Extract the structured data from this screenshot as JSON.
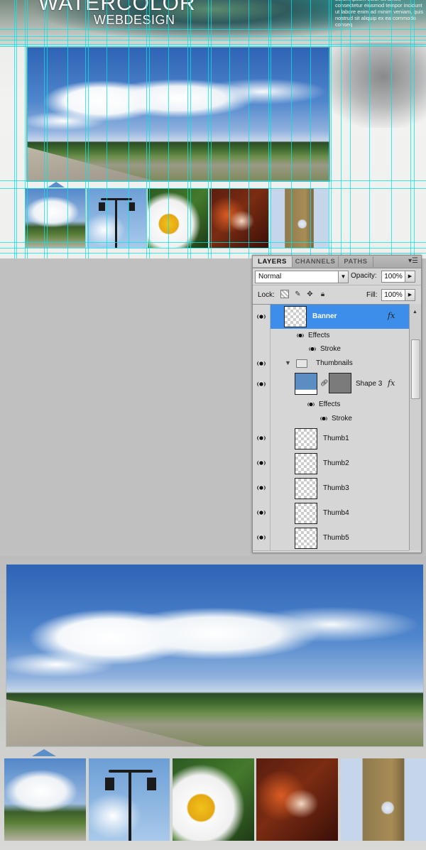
{
  "canvas": {
    "logo_title": "WATERCOLOR",
    "logo_subtitle": "WEBDESIGN",
    "lorem_text": "Lorem ipsum dolor sit amet, consectetur eiusmod tempor incidunt ut labore enim ad minim veniam, quis nostrud sit aliquip ex ea commodo conseq",
    "banner_image": "landscape-clouds-road",
    "thumbnails": [
      "clouds-landscape",
      "street-lamp",
      "bee-on-daisy",
      "violin-hands",
      "big-ben-clock"
    ]
  },
  "layers_panel": {
    "tabs": [
      "LAYERS",
      "CHANNELS",
      "PATHS"
    ],
    "active_tab": "LAYERS",
    "menu_icon": "panel-menu-icon",
    "blend_mode": "Normal",
    "opacity_label": "Opacity:",
    "opacity_value": "100%",
    "lock_label": "Lock:",
    "fill_label": "Fill:",
    "fill_value": "100%",
    "fx": "fx",
    "layers": [
      {
        "name": "Banner",
        "selected": true,
        "visible": true
      },
      {
        "name": "Effects"
      },
      {
        "name": "Stroke"
      },
      {
        "name": "Thumbnails",
        "type": "group",
        "visible": true
      },
      {
        "name": "Shape 3",
        "visible": true
      },
      {
        "name": "Effects"
      },
      {
        "name": "Stroke"
      },
      {
        "name": "Thumb1",
        "visible": true
      },
      {
        "name": "Thumb2",
        "visible": true
      },
      {
        "name": "Thumb3",
        "visible": true
      },
      {
        "name": "Thumb4",
        "visible": true
      },
      {
        "name": "Thumb5",
        "visible": true
      }
    ],
    "selection_color": "#3d8eea"
  }
}
